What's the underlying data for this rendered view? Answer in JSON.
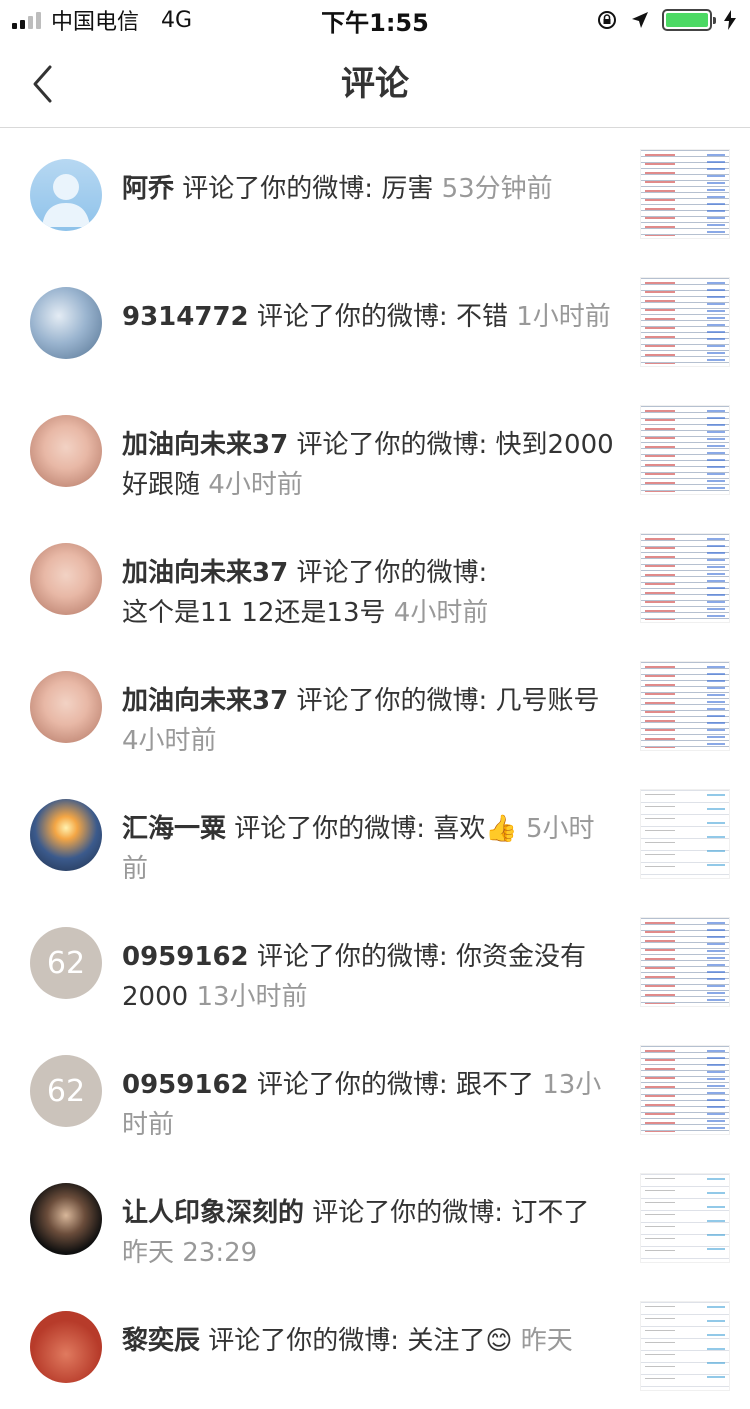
{
  "status_bar": {
    "carrier": "中国电信",
    "network": "4G",
    "time": "下午1:55"
  },
  "nav": {
    "title": "评论"
  },
  "items": [
    {
      "name": "阿乔",
      "action": "评论了你的微博:",
      "content": "厉害",
      "time": "53分钟前",
      "avatar": "default-avatar"
    },
    {
      "name": "9314772",
      "action": "评论了你的微博:",
      "content": "不错",
      "time": "1小时前",
      "avatar": "sky-photo"
    },
    {
      "name": "加油向未来37",
      "action": "评论了你的微博:",
      "content": "快到2000好跟随",
      "time": "4小时前",
      "avatar": "baby-photo"
    },
    {
      "name": "加油向未来37",
      "action": "评论了你的微博:",
      "content": "这个是11 12还是13号",
      "time": "4小时前",
      "avatar": "baby-photo"
    },
    {
      "name": "加油向未来37",
      "action": "评论了你的微博:",
      "content": "几号账号",
      "time": "4小时前",
      "avatar": "baby-photo"
    },
    {
      "name": "汇海一粟",
      "action": "评论了你的微博:",
      "content": "喜欢👍",
      "time": "5小时前",
      "avatar": "sunset-photo"
    },
    {
      "name": "0959162",
      "action": "评论了你的微博:",
      "content": "你资金没有2000",
      "time": "13小时前",
      "avatar_text": "62"
    },
    {
      "name": "0959162",
      "action": "评论了你的微博:",
      "content": "跟不了",
      "time": "13小时前",
      "avatar_text": "62"
    },
    {
      "name": "让人印象深刻的",
      "action": "评论了你的微博:",
      "content": "订不了",
      "time": "昨天 23:29",
      "avatar": "man-photo"
    },
    {
      "name": "黎奕辰",
      "action": "评论了你的微博:",
      "content": "关注了😊",
      "time": "昨天",
      "avatar": "red-photo"
    }
  ]
}
